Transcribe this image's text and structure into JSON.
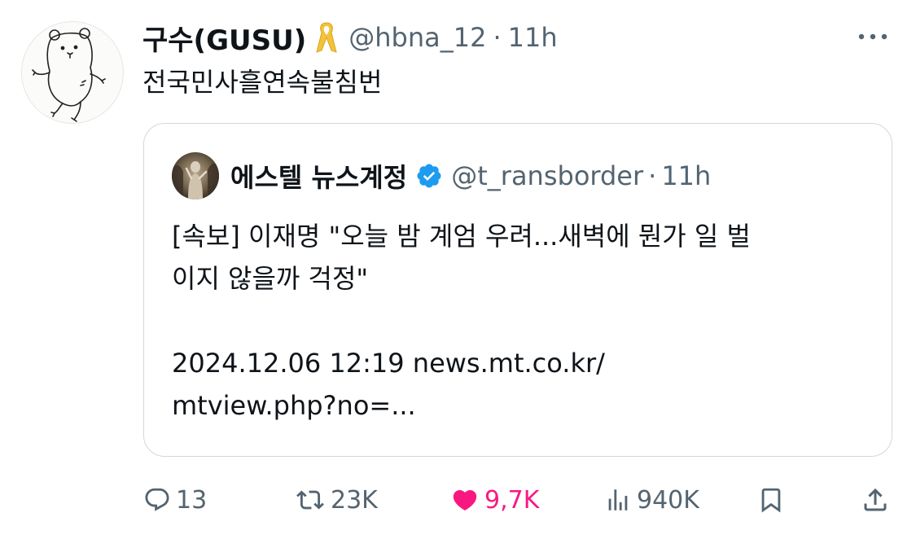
{
  "tweet": {
    "author": {
      "display_name": "구수(GUSU)",
      "handle": "@hbna_12",
      "badge_icon": "yellow-ribbon-icon"
    },
    "separator": "·",
    "time": "11h",
    "text": "전국민사흘연속불침번",
    "more_icon": "more-icon"
  },
  "quote": {
    "author": {
      "display_name": "에스텔 뉴스계정",
      "handle": "@t_ransborder",
      "verified_icon": "verified-badge-icon"
    },
    "separator": "·",
    "time": "11h",
    "lines": [
      "[속보] 이재명 \"오늘 밤 계엄 우려...새벽에 뭔가 일 벌",
      "이지 않을까 걱정\"",
      "",
      "2024.12.06 12:19 news.mt.co.kr/",
      "mtview.php?no=..."
    ]
  },
  "actions": {
    "reply": {
      "icon": "reply-icon",
      "count": "13"
    },
    "retweet": {
      "icon": "retweet-icon",
      "count": "23K"
    },
    "like": {
      "icon": "heart-icon",
      "count": "9,7K",
      "liked": true
    },
    "views": {
      "icon": "views-icon",
      "count": "940K"
    },
    "bookmark": {
      "icon": "bookmark-icon"
    },
    "share": {
      "icon": "share-icon"
    }
  },
  "colors": {
    "text_primary": "#0f1419",
    "text_secondary": "#536471",
    "like_active": "#f91880",
    "verified": "#1d9bf0",
    "ribbon": "#f3c23a",
    "card_border": "#cfd9de"
  }
}
